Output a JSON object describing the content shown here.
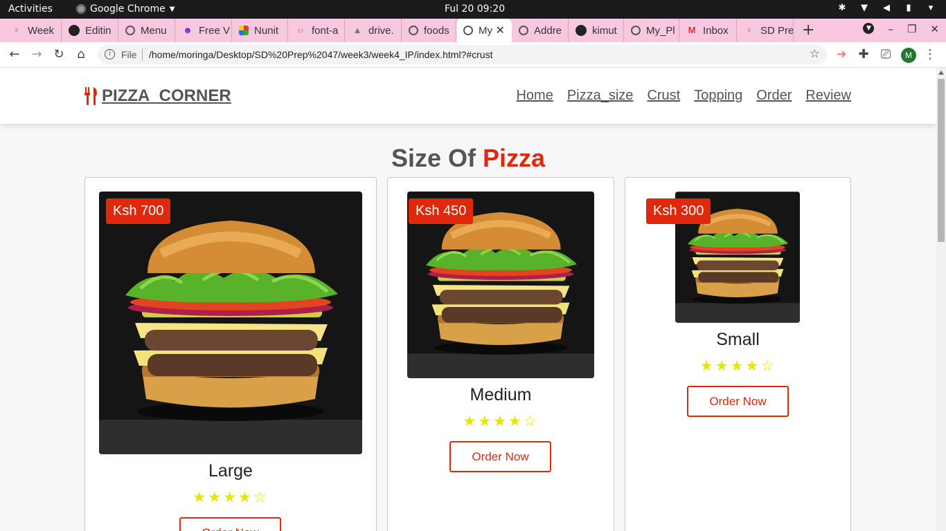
{
  "system": {
    "activities": "Activities",
    "app_name": "Google Chrome",
    "clock": "Ful 20  09:20"
  },
  "tabs": [
    {
      "label": "Week",
      "icon": "plant-icon"
    },
    {
      "label": "Editin",
      "icon": "github-icon"
    },
    {
      "label": "Menu",
      "icon": "globe-icon"
    },
    {
      "label": "Free V",
      "icon": "mask-icon"
    },
    {
      "label": "Nunit",
      "icon": "grid-icon"
    },
    {
      "label": "font-a",
      "icon": "code-icon"
    },
    {
      "label": "drive.",
      "icon": "drive-icon"
    },
    {
      "label": "foods",
      "icon": "globe-icon"
    },
    {
      "label": "My",
      "icon": "globe-icon",
      "active": true
    },
    {
      "label": "Addre",
      "icon": "globe-icon"
    },
    {
      "label": "kimut",
      "icon": "github-icon"
    },
    {
      "label": "My_Pl",
      "icon": "globe-icon"
    },
    {
      "label": "Inbox",
      "icon": "gmail-icon"
    },
    {
      "label": "SD Pre",
      "icon": "plant-icon"
    }
  ],
  "browser": {
    "file_label": "File",
    "url": "/home/moringa/Desktop/SD%20Prep%2047/week3/week4_IP/index.html?#crust",
    "profile_initial": "M"
  },
  "site": {
    "brand": "PIZZA_CORNER",
    "nav": [
      "Home",
      "Pizza_size",
      "Crust",
      "Topping",
      "Order",
      "Review"
    ],
    "section_title_a": "Size Of ",
    "section_title_b": "Pizza",
    "accent_color": "#e0280c",
    "star_color": "#e6e600",
    "cards": [
      {
        "price": "Ksh 700",
        "name": "Large",
        "rating": 4,
        "max_rating": 5,
        "button": "Order Now"
      },
      {
        "price": "Ksh 450",
        "name": "Medium",
        "rating": 4,
        "max_rating": 5,
        "button": "Order Now"
      },
      {
        "price": "Ksh 300",
        "name": "Small",
        "rating": 4,
        "max_rating": 5,
        "button": "Order Now"
      }
    ]
  }
}
